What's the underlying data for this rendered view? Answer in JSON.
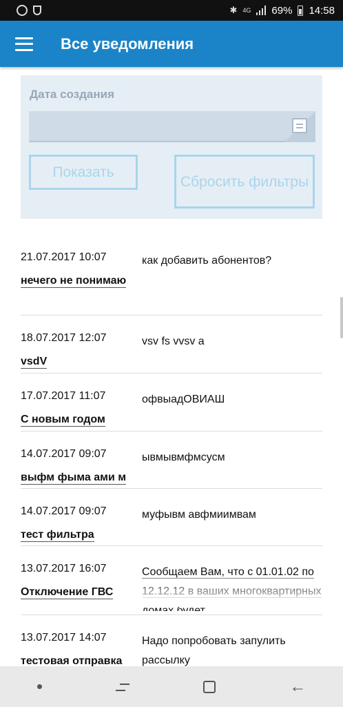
{
  "status_bar": {
    "network": "4G",
    "battery": "69%",
    "time": "14:58"
  },
  "app_bar": {
    "title": "Все уведомления"
  },
  "filters": {
    "date_label": "Дата создания",
    "date_value": "",
    "show_button": "Показать",
    "reset_button": "Сбросить фильтры"
  },
  "notifications": [
    {
      "date": "21.07.2017 10:07",
      "title": "нечего не понимаю",
      "text": "как добавить абонентов?"
    },
    {
      "date": "18.07.2017 12:07",
      "title": "vsdV",
      "text": "vsv fs vvsv a"
    },
    {
      "date": "17.07.2017 11:07",
      "title": "С новым годом",
      "text": "офвыадОВИАШ"
    },
    {
      "date": "14.07.2017 09:07",
      "title": "выфм фыма ами м",
      "text": "ывмывмфмсусм"
    },
    {
      "date": "14.07.2017 09:07",
      "title": "тест фильтра",
      "text": "муфывм авфмиимвам"
    },
    {
      "date": "13.07.2017 16:07",
      "title": "Отключение ГВС",
      "text": "Сообщаем Вам, что с 01.01.02 по 12.12.12 в ваших многоквартирных домах будет"
    },
    {
      "date": "13.07.2017 14:07",
      "title": "тестовая отправка",
      "text": "Надо попробовать запулить рассылку"
    }
  ],
  "nav_bar": {
    "back_glyph": "←"
  }
}
